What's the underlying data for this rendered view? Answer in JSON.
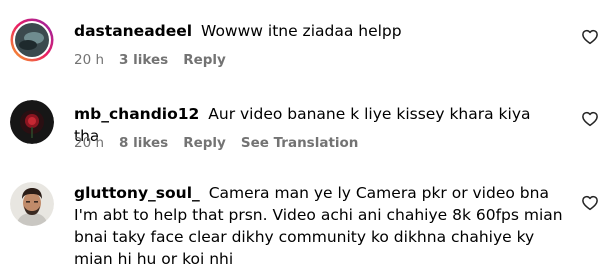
{
  "comments": [
    {
      "username": "dastaneadeel",
      "text": "Wowww itne ziadaa helpp",
      "time": "20 h",
      "likes": "3 likes",
      "reply": "Reply",
      "translation": ""
    },
    {
      "username": "mb_chandio12",
      "text": "Aur video banane k liye kissey khara kiya tha",
      "time": "20 h",
      "likes": "8 likes",
      "reply": "Reply",
      "translation": "See Translation"
    },
    {
      "username": "gluttony_soul_",
      "text": "Camera man ye ly Camera pkr or video bna I'm abt to help that prsn. Video achi ani chahiye 8k 60fps mian bnai taky face clear dikhy community ko dikhna chahiye ky mian hi hu or koi nhi",
      "time": "",
      "likes": "",
      "reply": "",
      "translation": ""
    }
  ],
  "icons": {
    "like": "heart-outline-icon"
  }
}
